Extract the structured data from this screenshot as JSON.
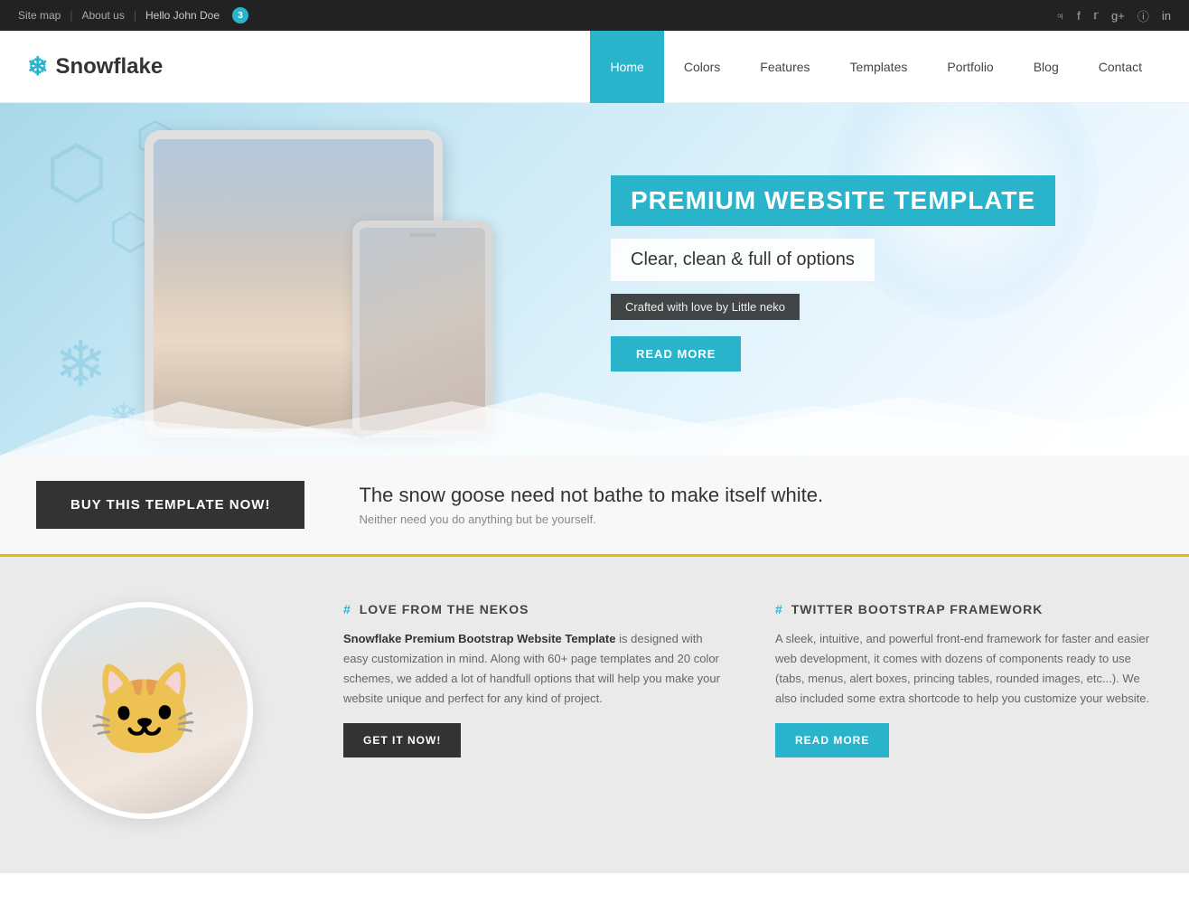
{
  "topbar": {
    "sitemap": "Site map",
    "about": "About us",
    "hello": "Hello John Doe",
    "badge": "3",
    "socials": [
      "rss",
      "facebook",
      "twitter",
      "google+",
      "instagram",
      "linkedin"
    ]
  },
  "header": {
    "logo_text": "Snowflake",
    "nav_items": [
      {
        "label": "Home",
        "active": true
      },
      {
        "label": "Colors",
        "active": false
      },
      {
        "label": "Features",
        "active": false
      },
      {
        "label": "Templates",
        "active": false
      },
      {
        "label": "Portfolio",
        "active": false
      },
      {
        "label": "Blog",
        "active": false
      },
      {
        "label": "Contact",
        "active": false
      }
    ]
  },
  "hero": {
    "title": "PREMIUM WEBSITE TEMPLATE",
    "subtitle": "Clear, clean & full of options",
    "crafted": "Crafted with love by Little neko",
    "read_more": "READ MORE"
  },
  "cta": {
    "button": "BUY THIS TEMPLATE NOW!",
    "heading": "The snow goose need not bathe to make itself white.",
    "subtext": "Neither need you do anything but be yourself."
  },
  "features": {
    "col1": {
      "heading": "LOVE FROM THE NEKOS",
      "bold_text": "Snowflake Premium Bootstrap Website Template",
      "text": "is designed with easy customization in mind. Along with 60+ page templates and 20 color schemes, we added a lot of handfull options that will help you make your website unique and perfect for any kind of project.",
      "button": "GET IT NOW!"
    },
    "col2": {
      "heading": "TWITTER BOOTSTRAP FRAMEWORK",
      "text": "A sleek, intuitive, and powerful front-end framework for faster and easier web development, it comes with dozens of components ready to use (tabs, menus, alert boxes, princing tables, rounded images, etc...). We also included some extra shortcode to help you customize your website.",
      "button": "READ MORE"
    }
  }
}
